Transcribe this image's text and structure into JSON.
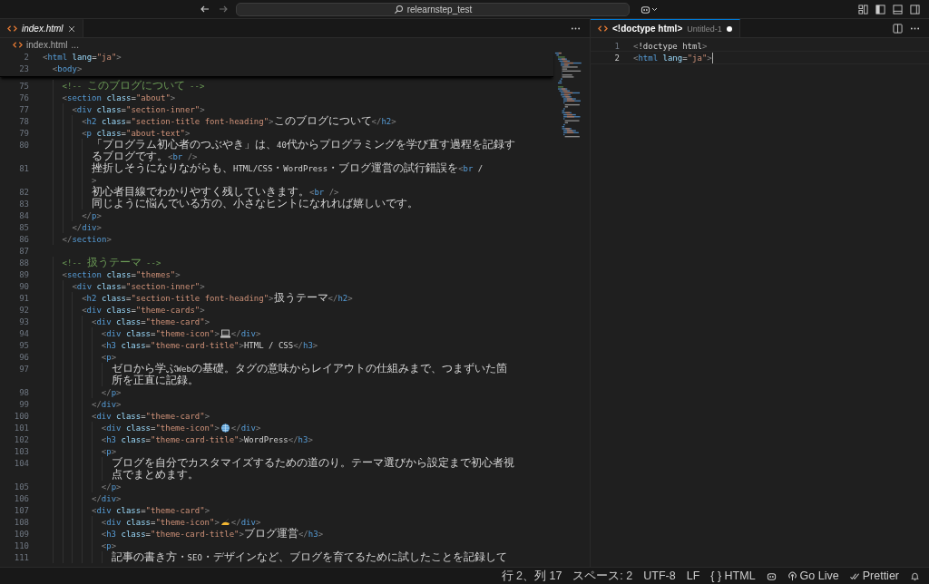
{
  "title_bar": {
    "search": "relearnstep_test"
  },
  "left_group": {
    "focused": false,
    "tabs": [
      {
        "label": "index.html",
        "preview": true,
        "selected": true
      }
    ],
    "breadcrumb": [
      "index.html",
      "..."
    ],
    "sticky": [
      {
        "number": "2",
        "text": "<html lang=\"ja\">"
      },
      {
        "number": "23",
        "text": "  <body>"
      }
    ],
    "lines": [
      {
        "number": "75",
        "text": "    <!-- このブログについて -->"
      },
      {
        "number": "76",
        "text": "    <section class=\"about\">"
      },
      {
        "number": "77",
        "text": "      <div class=\"section-inner\">"
      },
      {
        "number": "78",
        "text": "        <h2 class=\"section-title font-heading\">このブログについて</h2>"
      },
      {
        "number": "79",
        "text": "        <p class=\"about-text\">"
      },
      {
        "number": "80",
        "text": "          「プログラム初心者のつぶやき」は、40代からプログラミングを学び直す過程を記録す"
      },
      {
        "text": "          るブログです。<br />"
      },
      {
        "number": "81",
        "text": "          挫折しそうになりながらも、HTML/CSS・WordPress・ブログ運営の試行錯誤を<br /"
      },
      {
        "text": "          >"
      },
      {
        "number": "82",
        "text": "          初心者目線でわかりやすく残していきます。<br />"
      },
      {
        "number": "83",
        "text": "          同じように悩んでいる方の、小さなヒントになれれば嬉しいです。"
      },
      {
        "number": "84",
        "text": "        </p>"
      },
      {
        "number": "85",
        "text": "      </div>"
      },
      {
        "number": "86",
        "text": "    </section>"
      },
      {
        "number": "87"
      },
      {
        "number": "88",
        "text": "    <!-- 扱うテーマ -->"
      },
      {
        "number": "89",
        "text": "    <section class=\"themes\">"
      },
      {
        "number": "90",
        "text": "      <div class=\"section-inner\">"
      },
      {
        "number": "91",
        "text": "        <h2 class=\"section-title font-heading\">扱うテーマ</h2>"
      },
      {
        "number": "92",
        "text": "        <div class=\"theme-cards\">"
      },
      {
        "number": "93",
        "text": "          <div class=\"theme-card\">"
      },
      {
        "number": "94",
        "text": "            <div class=\"theme-icon\">",
        "kind": "laptop",
        "after": "</div>"
      },
      {
        "number": "95",
        "text": "            <h3 class=\"theme-card-title\">HTML / CSS</h3>"
      },
      {
        "number": "96",
        "text": "            <p>"
      },
      {
        "number": "97",
        "text": "              ゼロから学ぶWebの基礎。タグの意味からレイアウトの仕組みまで、つまずいた箇"
      },
      {
        "text": "              所を正直に記録。"
      },
      {
        "number": "98",
        "text": "            </p>"
      },
      {
        "number": "99",
        "text": "          </div>"
      },
      {
        "number": "100",
        "text": "          <div class=\"theme-card\">"
      },
      {
        "number": "101",
        "text": "            <div class=\"theme-icon\">",
        "kind": "globe",
        "after": "</div>"
      },
      {
        "number": "102",
        "text": "            <h3 class=\"theme-card-title\">WordPress</h3>"
      },
      {
        "number": "103",
        "text": "            <p>"
      },
      {
        "number": "104",
        "text": "              ブログを自分でカスタマイズするための道のり。テーマ選びから設定まで初心者視"
      },
      {
        "text": "              点でまとめます。"
      },
      {
        "number": "105",
        "text": "            </p>"
      },
      {
        "number": "106",
        "text": "          </div>"
      },
      {
        "number": "107",
        "text": "          <div class=\"theme-card\">"
      },
      {
        "number": "108",
        "text": "            <div class=\"theme-icon\">",
        "kind": "hand",
        "after": "</div>"
      },
      {
        "number": "109",
        "text": "            <h3 class=\"theme-card-title\">ブログ運営</h3>"
      },
      {
        "number": "110",
        "text": "            <p>"
      },
      {
        "number": "111",
        "text": "              記事の書き方・SEO・デザインなど、ブログを育てるために試したことを記録して"
      }
    ]
  },
  "right_group": {
    "focused": true,
    "tabs": [
      {
        "label": "<!doctype html>",
        "description": "Untitled-1",
        "dirty": true,
        "selected": true
      }
    ],
    "lines": [
      {
        "number": "1",
        "text": "<!doctype html>",
        "current": false
      },
      {
        "number": "2",
        "text": "<html lang=\"ja\">",
        "current": true
      }
    ]
  },
  "status_bar": [
    {
      "kind": "text",
      "text": "行 2、列 17"
    },
    {
      "kind": "text",
      "text": "スペース: 2"
    },
    {
      "kind": "text",
      "text": "UTF-8"
    },
    {
      "kind": "text",
      "text": "LF"
    },
    {
      "kind": "text",
      "text": "{ } HTML"
    },
    {
      "kind": "copilot"
    },
    {
      "kind": "golive",
      "text": "Go Live"
    },
    {
      "kind": "prettier",
      "text": "Prettier"
    },
    {
      "kind": "bell"
    }
  ]
}
